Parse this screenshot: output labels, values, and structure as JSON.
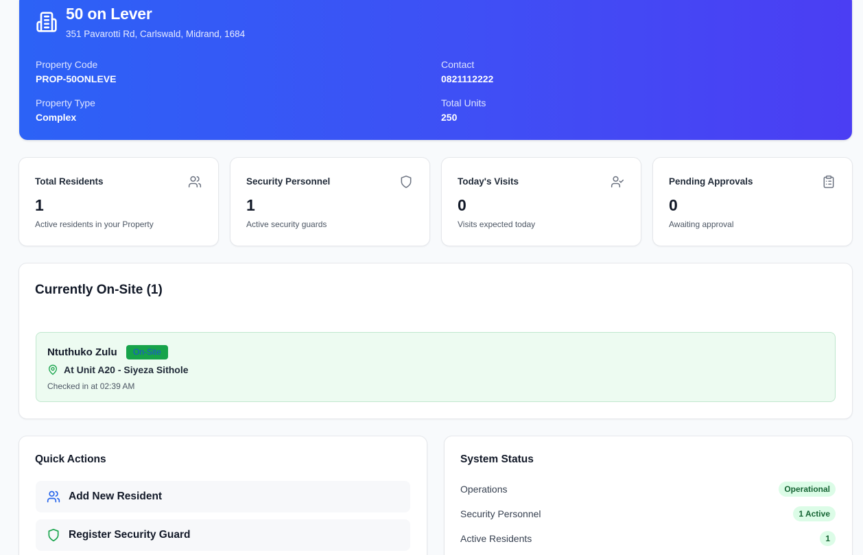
{
  "property": {
    "name": "50 on Lever",
    "address": "351 Pavarotti Rd, Carlswald, Midrand, 1684",
    "fields": {
      "code_label": "Property Code",
      "code_value": "PROP-50ONLEVE",
      "contact_label": "Contact",
      "contact_value": "0821112222",
      "type_label": "Property Type",
      "type_value": "Complex",
      "units_label": "Total Units",
      "units_value": "250"
    }
  },
  "stats": [
    {
      "title": "Total Residents",
      "value": "1",
      "subtitle": "Active residents in your Property",
      "icon": "users-icon"
    },
    {
      "title": "Security Personnel",
      "value": "1",
      "subtitle": "Active security guards",
      "icon": "shield-icon"
    },
    {
      "title": "Today's Visits",
      "value": "0",
      "subtitle": "Visits expected today",
      "icon": "user-check-icon"
    },
    {
      "title": "Pending Approvals",
      "value": "0",
      "subtitle": "Awaiting approval",
      "icon": "clipboard-icon"
    }
  ],
  "onsite": {
    "title": "Currently On-Site (1)",
    "visitors": [
      {
        "name": "Ntuthuko Zulu",
        "badge": "On-Site",
        "location": "At Unit A20 - Siyeza Sithole",
        "checked_in": "Checked in at 02:39 AM"
      }
    ]
  },
  "quick_actions": {
    "title": "Quick Actions",
    "items": [
      {
        "label": "Add New Resident",
        "icon": "users-icon"
      },
      {
        "label": "Register Security Guard",
        "icon": "shield-icon"
      }
    ]
  },
  "system_status": {
    "title": "System Status",
    "rows": [
      {
        "label": "Operations",
        "value": "Operational"
      },
      {
        "label": "Security Personnel",
        "value": "1 Active"
      },
      {
        "label": "Active Residents",
        "value": "1"
      }
    ]
  },
  "colors": {
    "hero_start": "#2c62f6",
    "hero_end": "#4b3ef3",
    "success": "#16a34a",
    "success_bg": "#edfbf1",
    "accent_blue": "#2563eb"
  }
}
